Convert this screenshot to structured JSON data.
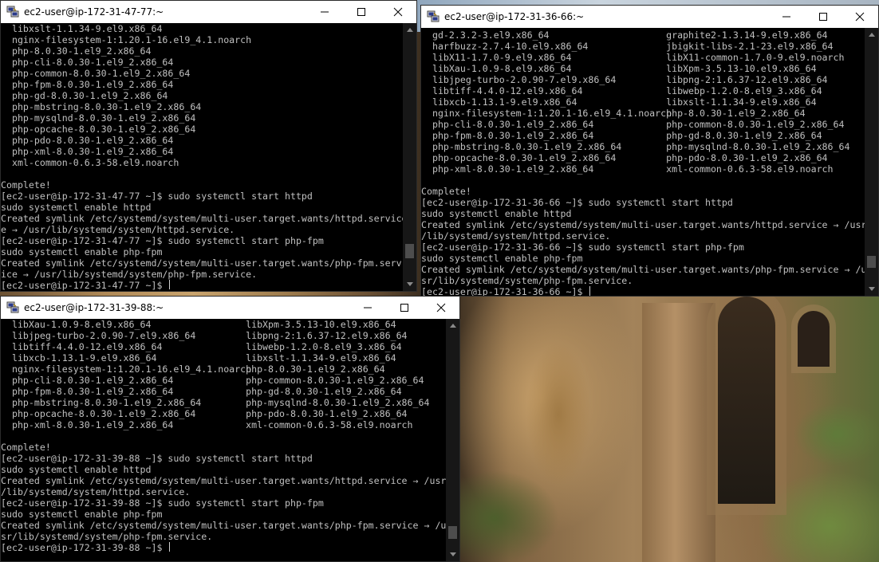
{
  "windows": [
    {
      "title": "ec2-user@ip-172-31-47-77:~",
      "columns": 1,
      "lines": [
        [
          "  libxslt-1.1.34-9.el9.x86_64"
        ],
        [
          "  nginx-filesystem-1:1.20.1-16.el9_4.1.noarch"
        ],
        [
          "  php-8.0.30-1.el9_2.x86_64"
        ],
        [
          "  php-cli-8.0.30-1.el9_2.x86_64"
        ],
        [
          "  php-common-8.0.30-1.el9_2.x86_64"
        ],
        [
          "  php-fpm-8.0.30-1.el9_2.x86_64"
        ],
        [
          "  php-gd-8.0.30-1.el9_2.x86_64"
        ],
        [
          "  php-mbstring-8.0.30-1.el9_2.x86_64"
        ],
        [
          "  php-mysqlnd-8.0.30-1.el9_2.x86_64"
        ],
        [
          "  php-opcache-8.0.30-1.el9_2.x86_64"
        ],
        [
          "  php-pdo-8.0.30-1.el9_2.x86_64"
        ],
        [
          "  php-xml-8.0.30-1.el9_2.x86_64"
        ],
        [
          "  xml-common-0.6.3-58.el9.noarch"
        ],
        [
          ""
        ],
        [
          "Complete!"
        ],
        [
          "[ec2-user@ip-172-31-47-77 ~]$ sudo systemctl start httpd"
        ],
        [
          "sudo systemctl enable httpd"
        ],
        [
          "Created symlink /etc/systemd/system/multi-user.target.wants/httpd.service"
        ],
        [
          "e → /usr/lib/systemd/system/httpd.service."
        ],
        [
          "[ec2-user@ip-172-31-47-77 ~]$ sudo systemctl start php-fpm"
        ],
        [
          "sudo systemctl enable php-fpm"
        ],
        [
          "Created symlink /etc/systemd/system/multi-user.target.wants/php-fpm.serv"
        ],
        [
          "ice → /usr/lib/systemd/system/php-fpm.service."
        ],
        [
          "[ec2-user@ip-172-31-47-77 ~]$ "
        ]
      ],
      "scroll_thumb_top_fraction": 0.86,
      "scroll_thumb_size_fraction": 0.06
    },
    {
      "title": "ec2-user@ip-172-31-36-66:~",
      "columns": 2,
      "lines": [
        [
          "  gd-2.3.2-3.el9.x86_64",
          "graphite2-1.3.14-9.el9.x86_64"
        ],
        [
          "  harfbuzz-2.7.4-10.el9.x86_64",
          "jbigkit-libs-2.1-23.el9.x86_64"
        ],
        [
          "  libX11-1.7.0-9.el9.x86_64",
          "libX11-common-1.7.0-9.el9.noarch"
        ],
        [
          "  libXau-1.0.9-8.el9.x86_64",
          "libXpm-3.5.13-10.el9.x86_64"
        ],
        [
          "  libjpeg-turbo-2.0.90-7.el9.x86_64",
          "libpng-2:1.6.37-12.el9.x86_64"
        ],
        [
          "  libtiff-4.4.0-12.el9.x86_64",
          "libwebp-1.2.0-8.el9_3.x86_64"
        ],
        [
          "  libxcb-1.13.1-9.el9.x86_64",
          "libxslt-1.1.34-9.el9.x86_64"
        ],
        [
          "  nginx-filesystem-1:1.20.1-16.el9_4.1.noarch",
          "php-8.0.30-1.el9_2.x86_64"
        ],
        [
          "  php-cli-8.0.30-1.el9_2.x86_64",
          "php-common-8.0.30-1.el9_2.x86_64"
        ],
        [
          "  php-fpm-8.0.30-1.el9_2.x86_64",
          "php-gd-8.0.30-1.el9_2.x86_64"
        ],
        [
          "  php-mbstring-8.0.30-1.el9_2.x86_64",
          "php-mysqlnd-8.0.30-1.el9_2.x86_64"
        ],
        [
          "  php-opcache-8.0.30-1.el9_2.x86_64",
          "php-pdo-8.0.30-1.el9_2.x86_64"
        ],
        [
          "  php-xml-8.0.30-1.el9_2.x86_64",
          "xml-common-0.6.3-58.el9.noarch"
        ],
        [
          ""
        ],
        [
          "Complete!"
        ],
        [
          "[ec2-user@ip-172-31-36-66 ~]$ sudo systemctl start httpd"
        ],
        [
          "sudo systemctl enable httpd"
        ],
        [
          "Created symlink /etc/systemd/system/multi-user.target.wants/httpd.service → /usr"
        ],
        [
          "/lib/systemd/system/httpd.service."
        ],
        [
          "[ec2-user@ip-172-31-36-66 ~]$ sudo systemctl start php-fpm"
        ],
        [
          "sudo systemctl enable php-fpm"
        ],
        [
          "Created symlink /etc/systemd/system/multi-user.target.wants/php-fpm.service → /u"
        ],
        [
          "sr/lib/systemd/system/php-fpm.service."
        ],
        [
          "[ec2-user@ip-172-31-36-66 ~]$ "
        ]
      ],
      "scroll_thumb_top_fraction": 0.89,
      "scroll_thumb_size_fraction": 0.05
    },
    {
      "title": "ec2-user@ip-172-31-39-88:~",
      "columns": 2,
      "lines": [
        [
          "  libXau-1.0.9-8.el9.x86_64",
          "libXpm-3.5.13-10.el9.x86_64"
        ],
        [
          "  libjpeg-turbo-2.0.90-7.el9.x86_64",
          "libpng-2:1.6.37-12.el9.x86_64"
        ],
        [
          "  libtiff-4.4.0-12.el9.x86_64",
          "libwebp-1.2.0-8.el9_3.x86_64"
        ],
        [
          "  libxcb-1.13.1-9.el9.x86_64",
          "libxslt-1.1.34-9.el9.x86_64"
        ],
        [
          "  nginx-filesystem-1:1.20.1-16.el9_4.1.noarch",
          "php-8.0.30-1.el9_2.x86_64"
        ],
        [
          "  php-cli-8.0.30-1.el9_2.x86_64",
          "php-common-8.0.30-1.el9_2.x86_64"
        ],
        [
          "  php-fpm-8.0.30-1.el9_2.x86_64",
          "php-gd-8.0.30-1.el9_2.x86_64"
        ],
        [
          "  php-mbstring-8.0.30-1.el9_2.x86_64",
          "php-mysqlnd-8.0.30-1.el9_2.x86_64"
        ],
        [
          "  php-opcache-8.0.30-1.el9_2.x86_64",
          "php-pdo-8.0.30-1.el9_2.x86_64"
        ],
        [
          "  php-xml-8.0.30-1.el9_2.x86_64",
          "xml-common-0.6.3-58.el9.noarch"
        ],
        [
          ""
        ],
        [
          "Complete!"
        ],
        [
          "[ec2-user@ip-172-31-39-88 ~]$ sudo systemctl start httpd"
        ],
        [
          "sudo systemctl enable httpd"
        ],
        [
          "Created symlink /etc/systemd/system/multi-user.target.wants/httpd.service → /usr"
        ],
        [
          "/lib/systemd/system/httpd.service."
        ],
        [
          "[ec2-user@ip-172-31-39-88 ~]$ sudo systemctl start php-fpm"
        ],
        [
          "sudo systemctl enable php-fpm"
        ],
        [
          "Created symlink /etc/systemd/system/multi-user.target.wants/php-fpm.service → /u"
        ],
        [
          "sr/lib/systemd/system/php-fpm.service."
        ],
        [
          "[ec2-user@ip-172-31-39-88 ~]$ "
        ]
      ],
      "scroll_thumb_top_fraction": 0.9,
      "scroll_thumb_size_fraction": 0.06
    }
  ],
  "icons": {
    "app": "putty-icon",
    "minimize": "minimize-icon",
    "maximize": "maximize-icon",
    "close": "close-icon"
  },
  "colors": {
    "terminal_bg": "#000000",
    "terminal_fg": "#c0c0c0",
    "titlebar_bg": "#ffffff"
  }
}
